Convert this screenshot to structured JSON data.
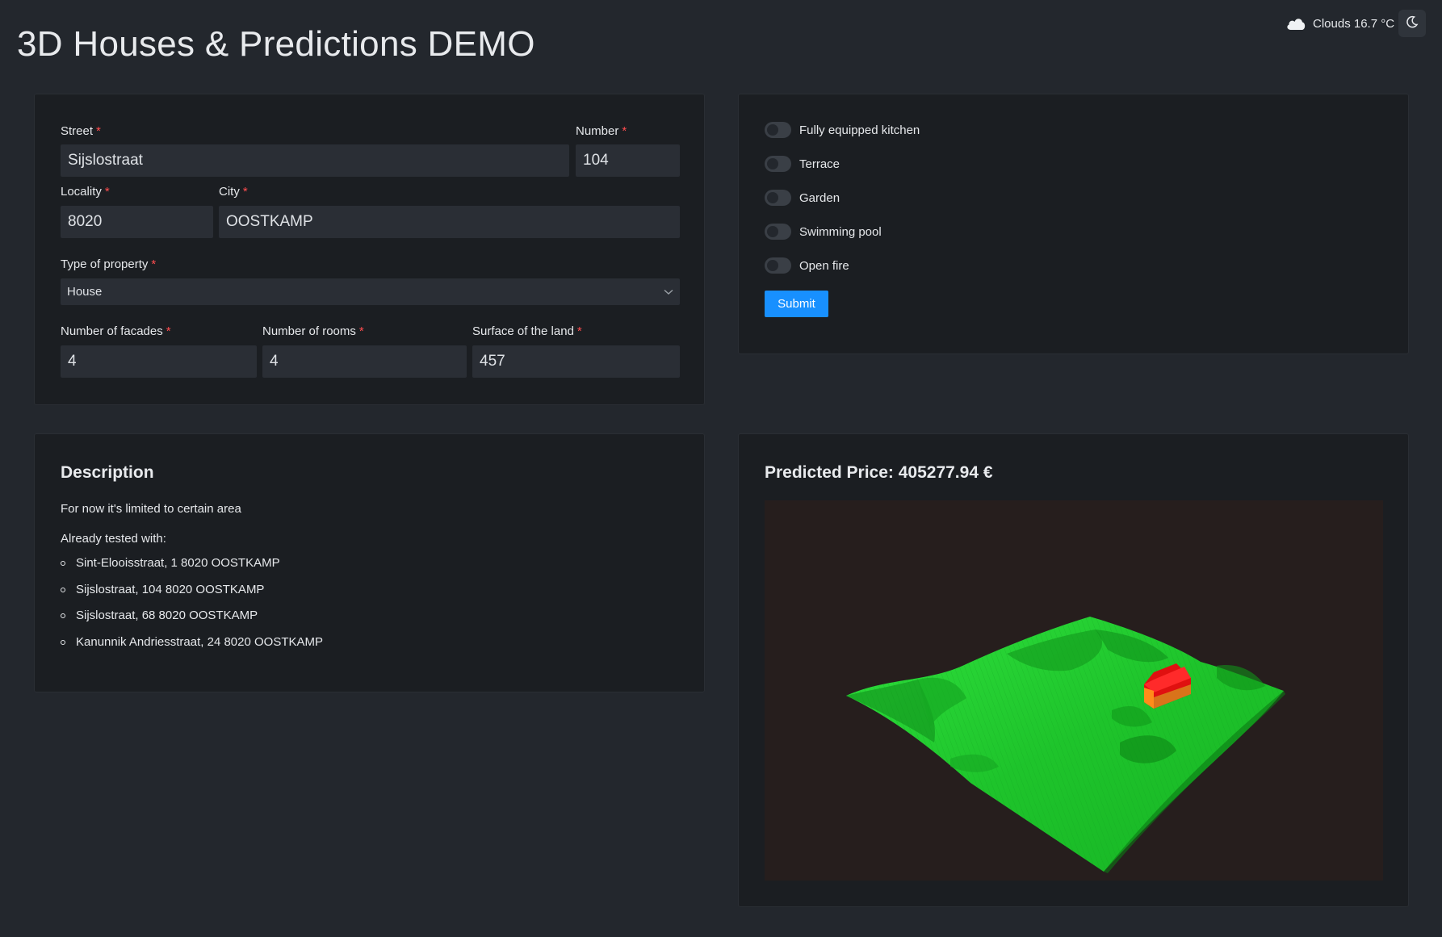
{
  "header": {
    "title": "3D Houses & Predictions DEMO",
    "weather_text": "Clouds 16.7 °C"
  },
  "form": {
    "street": {
      "label": "Street",
      "value": "Sijslostraat"
    },
    "number": {
      "label": "Number",
      "value": "104"
    },
    "locality": {
      "label": "Locality",
      "value": "8020"
    },
    "city": {
      "label": "City",
      "value": "OOSTKAMP"
    },
    "property_type": {
      "label": "Type of property",
      "value": "House"
    },
    "facades": {
      "label": "Number of facades",
      "value": "4"
    },
    "rooms": {
      "label": "Number of rooms",
      "value": "4"
    },
    "land": {
      "label": "Surface of the land",
      "value": "457"
    },
    "required_mark": "*"
  },
  "features": {
    "items": [
      {
        "label": "Fully equipped kitchen",
        "checked": false
      },
      {
        "label": "Terrace",
        "checked": false
      },
      {
        "label": "Garden",
        "checked": false
      },
      {
        "label": "Swimming pool",
        "checked": false
      },
      {
        "label": "Open fire",
        "checked": false
      }
    ],
    "submit_label": "Submit"
  },
  "description": {
    "heading": "Description",
    "line1": "For now it's limited to certain area",
    "line2": "Already tested with:",
    "addresses": [
      "Sint-Elooisstraat, 1 8020 OOSTKAMP",
      "Sijslostraat, 104 8020 OOSTKAMP",
      "Sijslostraat, 68 8020 OOSTKAMP",
      "Kanunnik Andriesstraat, 24 8020 OOSTKAMP"
    ]
  },
  "prediction": {
    "heading": "Predicted Price: 405277.94 €"
  },
  "colors": {
    "accent": "#1890ff",
    "required": "#ff4d4f",
    "terrain": "#1fcc2e",
    "house": "#e01010"
  }
}
